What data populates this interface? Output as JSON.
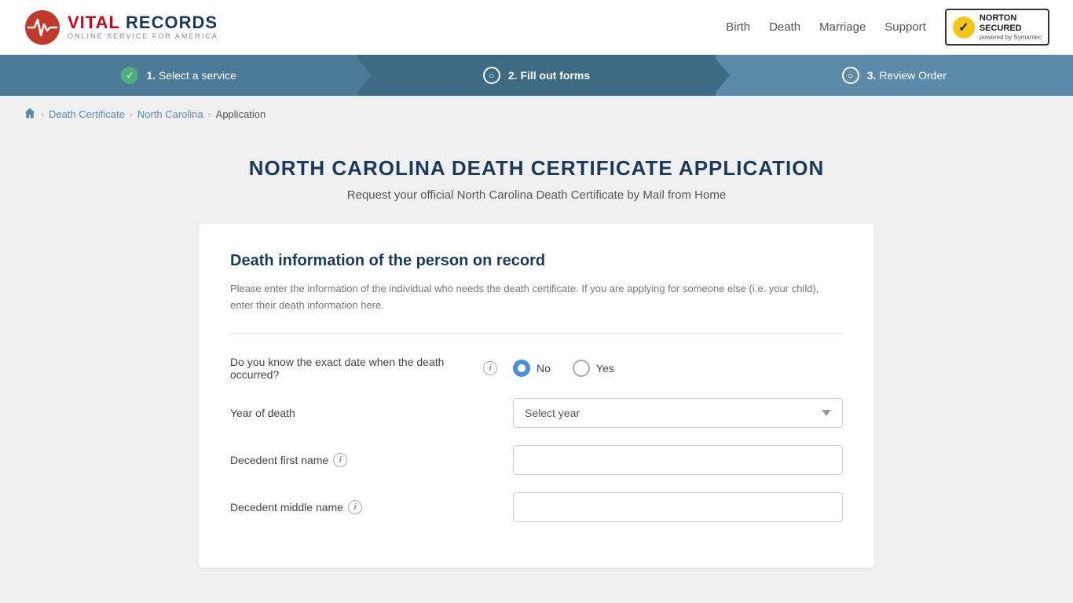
{
  "header": {
    "logo_brand": "VITAL",
    "logo_brand2": "RECORDS",
    "logo_subtitle": "ONLINE SERVICE FOR AMERICA",
    "nav": {
      "birth": "Birth",
      "death": "Death",
      "marriage": "Marriage",
      "support": "Support"
    },
    "norton": {
      "label": "NORTON",
      "label2": "SECURED",
      "powered": "powered by Symantec"
    }
  },
  "progress": {
    "step1": {
      "number": "1.",
      "label": "Select a service",
      "state": "completed"
    },
    "step2": {
      "number": "2.",
      "label": "Fill out forms",
      "state": "active"
    },
    "step3": {
      "number": "3.",
      "label": "Review Order",
      "state": "inactive"
    }
  },
  "breadcrumb": {
    "home": "Home",
    "death_certificate": "Death Certificate",
    "north_carolina": "North Carolina",
    "application": "Application"
  },
  "page": {
    "title": "NORTH CAROLINA DEATH CERTIFICATE APPLICATION",
    "subtitle": "Request your official North Carolina Death Certificate by Mail from Home"
  },
  "form": {
    "section_title": "Death information of the person on record",
    "section_desc": "Please enter the information of the individual who needs the death certificate. If you are applying for someone else (i.e. your child), enter their death information here.",
    "exact_date_question": "Do you know the exact date when the death occurred?",
    "exact_date_no": "No",
    "exact_date_yes": "Yes",
    "year_of_death_label": "Year of death",
    "year_placeholder": "Select year",
    "first_name_label": "Decedent first name",
    "middle_name_label": "Decedent middle name"
  }
}
